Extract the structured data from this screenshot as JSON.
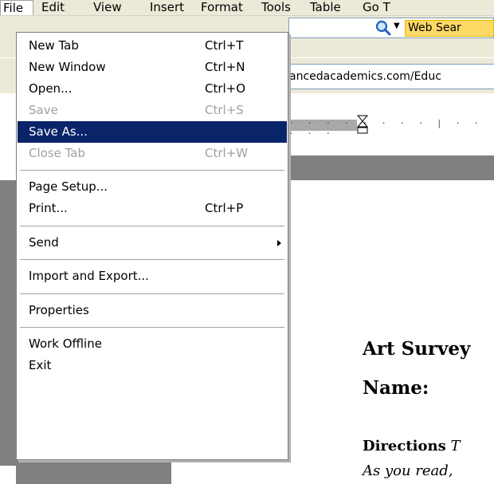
{
  "menubar": {
    "items": [
      {
        "label": "File"
      },
      {
        "label": "Edit"
      },
      {
        "label": "View"
      },
      {
        "label": "Insert"
      },
      {
        "label": "Format"
      },
      {
        "label": "Tools"
      },
      {
        "label": "Table"
      },
      {
        "label": "Go T"
      }
    ]
  },
  "search": {
    "label": "Web Sear",
    "icon": "magnifier-icon"
  },
  "address": {
    "url": "ancedacademics.com/Educ"
  },
  "file_menu": {
    "items": [
      {
        "label": "New Tab",
        "shortcut": "Ctrl+T",
        "state": "enabled"
      },
      {
        "label": "New Window",
        "shortcut": "Ctrl+N",
        "state": "enabled"
      },
      {
        "label": "Open...",
        "shortcut": "Ctrl+O",
        "state": "enabled"
      },
      {
        "label": "Save",
        "shortcut": "Ctrl+S",
        "state": "disabled"
      },
      {
        "label": "Save As...",
        "shortcut": "",
        "state": "selected"
      },
      {
        "label": "Close Tab",
        "shortcut": "Ctrl+W",
        "state": "disabled"
      },
      {
        "label": "Page Setup...",
        "shortcut": "",
        "state": "enabled"
      },
      {
        "label": "Print...",
        "shortcut": "Ctrl+P",
        "state": "enabled"
      },
      {
        "label": "Send",
        "shortcut": "",
        "state": "submenu"
      },
      {
        "label": "Import and Export...",
        "shortcut": "",
        "state": "enabled"
      },
      {
        "label": "Properties",
        "shortcut": "",
        "state": "enabled"
      },
      {
        "label": "Work Offline",
        "shortcut": "",
        "state": "enabled"
      },
      {
        "label": "Exit",
        "shortcut": "",
        "state": "enabled"
      }
    ]
  },
  "document": {
    "title": "Art Survey",
    "name_label": "Name:",
    "directions_label": "Directions",
    "directions_rest": "T",
    "as_you_read": "As you read,"
  },
  "colors": {
    "menu_bg": "#ece9d8",
    "selection": "#0a246a",
    "disabled_text": "#a0a0a0",
    "search_highlight": "#ffd966"
  }
}
